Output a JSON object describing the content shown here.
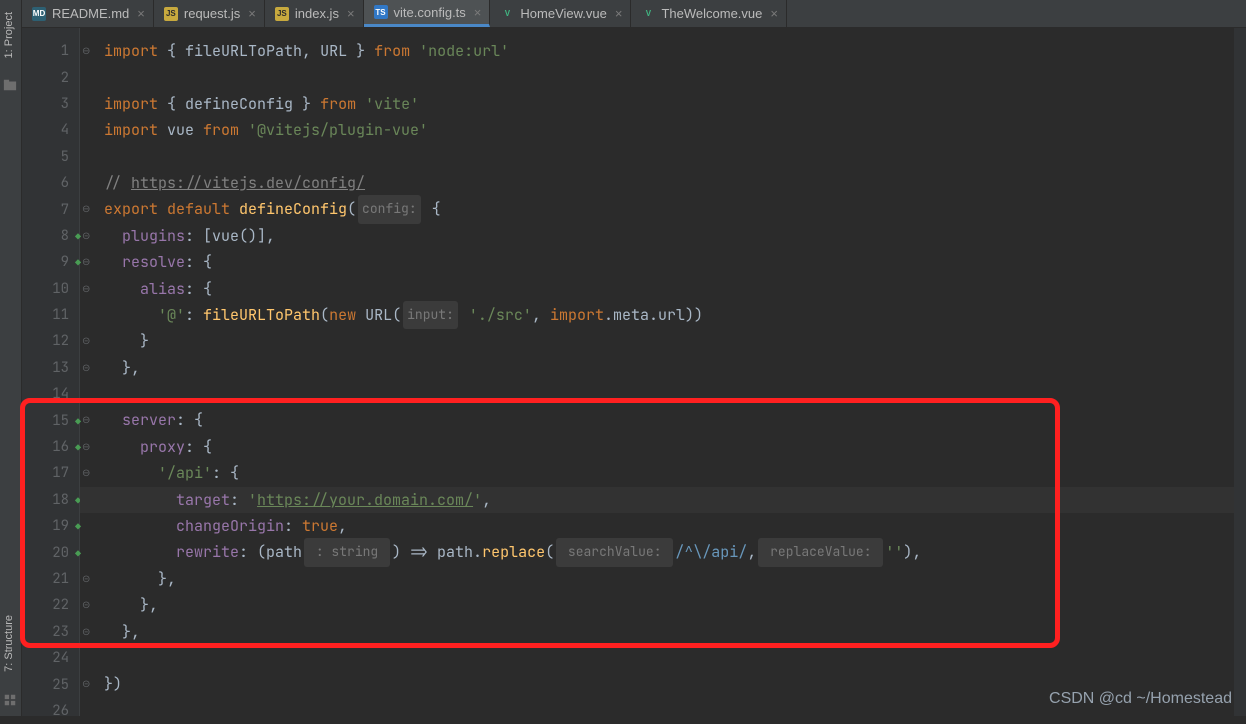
{
  "sidebar": {
    "project_label": "1: Project",
    "structure_label": "7: Structure"
  },
  "tabs": [
    {
      "label": "README.md",
      "icon": "md"
    },
    {
      "label": "request.js",
      "icon": "js"
    },
    {
      "label": "index.js",
      "icon": "js"
    },
    {
      "label": "vite.config.ts",
      "icon": "ts",
      "active": true
    },
    {
      "label": "HomeView.vue",
      "icon": "vue"
    },
    {
      "label": "TheWelcome.vue",
      "icon": "vue"
    }
  ],
  "gutter": {
    "lines": [
      "1",
      "2",
      "3",
      "4",
      "5",
      "6",
      "7",
      "8",
      "9",
      "10",
      "11",
      "12",
      "13",
      "14",
      "15",
      "16",
      "17",
      "18",
      "19",
      "20",
      "21",
      "22",
      "23",
      "24",
      "25",
      "26"
    ],
    "vcs_marks": [
      8,
      9,
      15,
      16,
      18,
      19,
      20
    ]
  },
  "code": {
    "l1_kw1": "import",
    "l1_pl1": " { ",
    "l1_fn1": "fileURLToPath",
    "l1_pl2": ", ",
    "l1_fn2": "URL",
    "l1_pl3": " } ",
    "l1_kw2": "from",
    "l1_str": " 'node:url'",
    "l3_kw1": "import",
    "l3_pl1": " { ",
    "l3_fn1": "defineConfig",
    "l3_pl2": " } ",
    "l3_kw2": "from",
    "l3_str": " 'vite'",
    "l4_kw1": "import",
    "l4_fn": " vue ",
    "l4_kw2": "from",
    "l4_str": " '@vitejs/plugin-vue'",
    "l6_cm1": "// ",
    "l6_url": "https://vitejs.dev/config/",
    "l7_kw1": "export default ",
    "l7_fn": "defineConfig",
    "l7_pl1": "(",
    "l7_hint": "config:",
    "l7_pl2": " {",
    "l8_prop": "  plugins",
    "l8_pl": ": [vue()],",
    "l9_prop": "  resolve",
    "l9_pl": ": {",
    "l10_prop": "    alias",
    "l10_pl": ": {",
    "l11_str1": "      '@'",
    "l11_pl1": ": ",
    "l11_fn1": "fileURLToPath",
    "l11_pl2": "(",
    "l11_kw": "new ",
    "l11_fn2": "URL",
    "l11_pl3": "(",
    "l11_hint": "input:",
    "l11_str2": " './src'",
    "l11_pl4": ", ",
    "l11_kw2": "import",
    "l11_pl5": ".meta.url))",
    "l12": "    }",
    "l13": "  },",
    "l15_prop": "  server",
    "l15_pl": ": {",
    "l16_prop": "    proxy",
    "l16_pl": ": {",
    "l17_str": "      '/api'",
    "l17_pl": ": {",
    "l18_prop": "        target",
    "l18_pl1": ": ",
    "l18_str_q1": "'",
    "l18_url": "https://your.domain.com/",
    "l18_str_q2": "'",
    "l18_pl2": ",",
    "l19_prop": "        changeOrigin",
    "l19_pl": ": ",
    "l19_bool": "true",
    "l19_c": ",",
    "l20_prop": "        rewrite",
    "l20_pl1": ": (path",
    "l20_hint1": " : string ",
    "l20_pl2": ") => path.",
    "l20_fn": "replace",
    "l20_pl3": "(",
    "l20_hint2": " searchValue: ",
    "l20_regex": "/^\\/api/",
    "l20_pl4": ",",
    "l20_hint3": " replaceValue: ",
    "l20_str": "''",
    "l20_pl5": "),",
    "l21": "      },",
    "l22": "    },",
    "l23": "  },",
    "l25": "})"
  },
  "watermark": "CSDN @cd ~/Homestead"
}
